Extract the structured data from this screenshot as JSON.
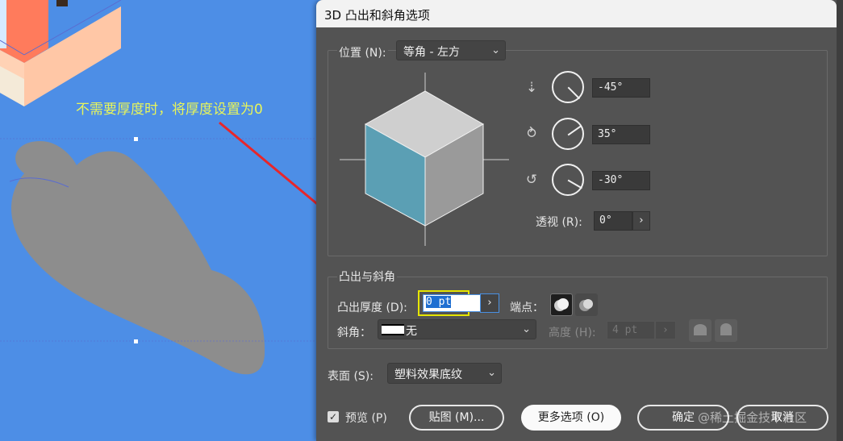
{
  "annotation": "不需要厚度时，将厚度设置为0",
  "dialog": {
    "title": "3D 凸出和斜角选项",
    "position_label": "位置 (N):",
    "position_value": "等角 - 左方",
    "rot_x": "-45°",
    "rot_y": "35°",
    "rot_z": "-30°",
    "perspective_label": "透视 (R):",
    "perspective_value": "0°",
    "extrude_section": "凸出与斜角",
    "depth_label": "凸出厚度 (D):",
    "depth_value": "0 pt",
    "cap_label": "端点：",
    "bevel_label": "斜角：",
    "bevel_value": "无",
    "height_label": "高度 (H):",
    "height_value": "4 pt",
    "surface_label": "表面 (S):",
    "surface_value": "塑料效果底纹",
    "preview_label": "预览 (P)",
    "map_button": "贴图 (M)...",
    "more_button": "更多选项 (O)",
    "ok_button": "确定",
    "cancel_button": "取消"
  },
  "watermark": "@稀土掘金技术社区",
  "colors": {
    "canvas": "#4d8ee6",
    "cube_left": "#5b9fb4",
    "cube_top": "#cfcfcf",
    "cube_right": "#9a9a9a",
    "highlight": "#e6e600",
    "annotation": "#e8f55a"
  }
}
